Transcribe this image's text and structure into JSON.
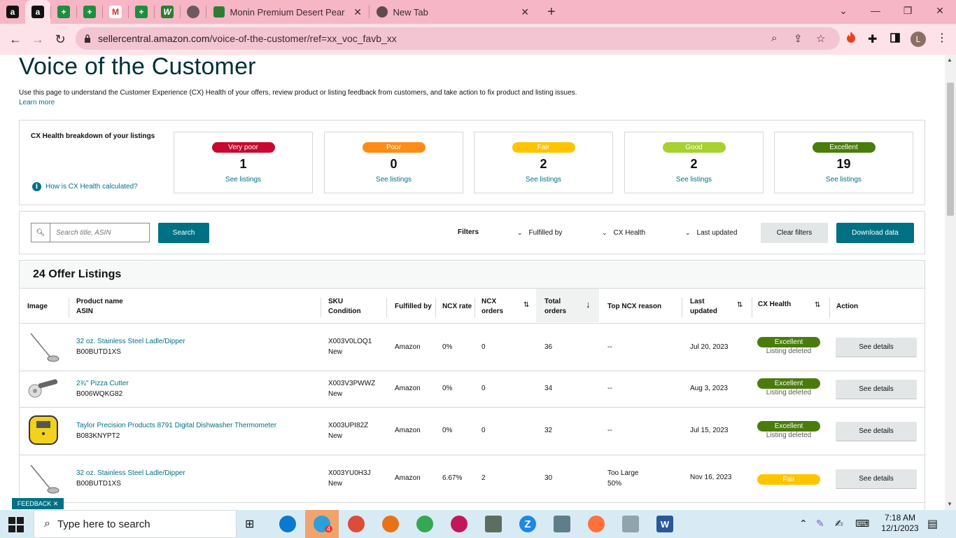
{
  "browser": {
    "tabs": [
      {
        "title": "Monin Premium Desert Pear Flav",
        "close": "✕"
      },
      {
        "title": "New Tab",
        "close": "✕"
      }
    ],
    "new_tab": "+",
    "url_domain": "sellercentral.amazon.com",
    "url_path": "/voice-of-the-customer/ref=xx_voc_favb_xx",
    "profile_initial": "L"
  },
  "page": {
    "title": "Voice of the Customer",
    "description": "Use this page to understand the Customer Experience (CX) Health of your offers, review product or listing feedback from customers, and take action to fix product and listing issues.",
    "learn_more": "Learn more",
    "breakdown_label": "CX Health breakdown of your listings",
    "how_calculated": "How is CX Health calculated?",
    "cards": [
      {
        "label": "Very poor",
        "count": "1",
        "link": "See listings",
        "color": "#c7092e"
      },
      {
        "label": "Poor",
        "count": "0",
        "link": "See listings",
        "color": "#ff8c17"
      },
      {
        "label": "Fair",
        "count": "2",
        "link": "See listings",
        "color": "#ffc400"
      },
      {
        "label": "Good",
        "count": "2",
        "link": "See listings",
        "color": "#a6d12e"
      },
      {
        "label": "Excellent",
        "count": "19",
        "link": "See listings",
        "color": "#4a7c0c"
      }
    ]
  },
  "filters": {
    "search_placeholder": "Search title, ASIN",
    "search_button": "Search",
    "label": "Filters",
    "fulfilled_by": "Fulfilled by",
    "cx_health": "CX Health",
    "last_updated": "Last updated",
    "clear": "Clear filters",
    "download": "Download data"
  },
  "listings": {
    "heading": "24 Offer Listings",
    "columns": {
      "image": "Image",
      "product": "Product name",
      "asin": "ASIN",
      "sku": "SKU",
      "condition": "Condition",
      "fulfilled": "Fulfilled by",
      "ncx_rate": "NCX rate",
      "ncx_orders_1": "NCX",
      "ncx_orders_2": "orders",
      "total_1": "Total",
      "total_2": "orders",
      "reason": "Top NCX reason",
      "updated_1": "Last",
      "updated_2": "updated",
      "health": "CX Health",
      "action": "Action"
    },
    "rows": [
      {
        "name": "32 oz. Stainless Steel Ladle/Dipper",
        "asin": "B00BUTD1XS",
        "sku": "X003V0LOQ1",
        "condition": "New",
        "fulfilled": "Amazon",
        "rate": "0%",
        "ncx": "0",
        "total": "36",
        "reason": "--",
        "reason_pct": "",
        "updated": "Jul 20, 2023",
        "health": "Excellent",
        "health_color": "#4a7c0c",
        "note": "Listing deleted",
        "action": "See details"
      },
      {
        "name": "2¾\" Pizza Cutter",
        "asin": "B006WQKG82",
        "sku": "X003V3PWWZ",
        "condition": "New",
        "fulfilled": "Amazon",
        "rate": "0%",
        "ncx": "0",
        "total": "34",
        "reason": "--",
        "reason_pct": "",
        "updated": "Aug 3, 2023",
        "health": "Excellent",
        "health_color": "#4a7c0c",
        "note": "Listing deleted",
        "action": "See details"
      },
      {
        "name": "Taylor Precision Products 8791 Digital Dishwasher Thermometer",
        "asin": "B083KNYPT2",
        "sku": "X003UPI82Z",
        "condition": "New",
        "fulfilled": "Amazon",
        "rate": "0%",
        "ncx": "0",
        "total": "32",
        "reason": "--",
        "reason_pct": "",
        "updated": "Jul 15, 2023",
        "health": "Excellent",
        "health_color": "#4a7c0c",
        "note": "Listing deleted",
        "action": "See details"
      },
      {
        "name": "32 oz. Stainless Steel Ladle/Dipper",
        "asin": "B00BUTD1XS",
        "sku": "X003YU0H3J",
        "condition": "New",
        "fulfilled": "Amazon",
        "rate": "6.67%",
        "ncx": "2",
        "total": "30",
        "reason": "Too Large",
        "reason_pct": "50%",
        "updated": "Nov 16, 2023",
        "health": "Fair",
        "health_color": "#ffc400",
        "note": "",
        "action": "See details"
      }
    ]
  },
  "feedback": "FEEDBACK ✕",
  "taskbar": {
    "search_placeholder": "Type here to search",
    "time": "7:18 AM",
    "date": "12/1/2023",
    "badge": "4"
  }
}
